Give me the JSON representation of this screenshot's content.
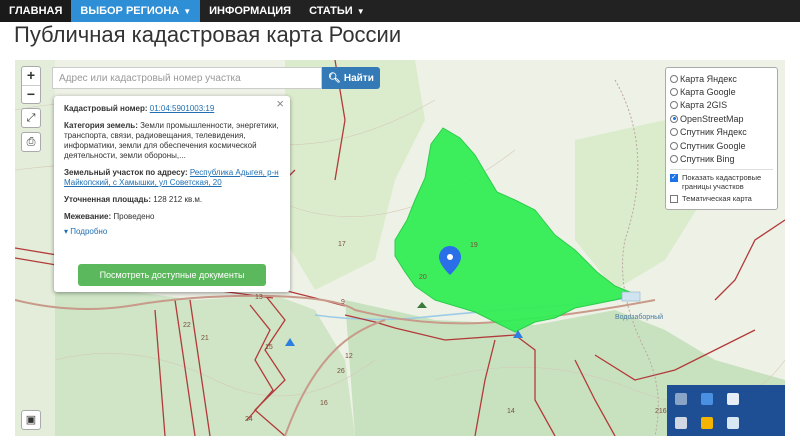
{
  "nav": {
    "items": [
      {
        "label": "ГЛАВНАЯ"
      },
      {
        "label": "ВЫБОР РЕГИОНА"
      },
      {
        "label": "ИНФОРМАЦИЯ"
      },
      {
        "label": "СТАТЬИ"
      }
    ]
  },
  "page": {
    "title": "Публичная кадастровая карта России"
  },
  "search": {
    "placeholder": "Адрес или кадастровый номер участка",
    "button_label": "Найти"
  },
  "info": {
    "cadastral_label": "Кадастровый номер:",
    "cadastral_value": "01:04:5901003:19",
    "category_label": "Категория земель:",
    "category_value": "Земли промышленности, энергетики, транспорта, связи, радиовещания, телевидения, информатики, земли для обеспечения космической деятельности, земли обороны,...",
    "address_label": "Земельный участок по адресу:",
    "address_value": "Республика Адыгея, р-н Майкопский, с Хамышки, ул Советская, 20",
    "area_label": "Уточненная площадь:",
    "area_value": "128 212 кв.м.",
    "survey_label": "Межевание:",
    "survey_value": "Проведено",
    "more_label": "Подробно",
    "docs_button": "Посмотреть доступные документы"
  },
  "layers": {
    "options": [
      {
        "label": "Карта Яндекс",
        "selected": false
      },
      {
        "label": "Карта Google",
        "selected": false
      },
      {
        "label": "Карта 2GIS",
        "selected": false
      },
      {
        "label": "OpenStreetMap",
        "selected": true
      },
      {
        "label": "Спутник Яндекс",
        "selected": false
      },
      {
        "label": "Спутник Google",
        "selected": false
      },
      {
        "label": "Спутник Bing",
        "selected": false
      }
    ],
    "show_borders": "Показать кадастровые границы участков",
    "thematic": "Тематическая карта"
  },
  "map_labels": {
    "l17": "17",
    "l20": "20",
    "l9": "9",
    "l15": "15",
    "l13": "13",
    "l12": "12",
    "l16": "16",
    "l24": "24",
    "l22": "22",
    "l21": "21",
    "l26": "26",
    "l14": "14",
    "l19": "19",
    "l216": "216",
    "reservoir": "Водозаборный"
  },
  "colors": {
    "nav_bg": "#222222",
    "region_active": "#2e8fd6",
    "parcel_fill": "#33ee55",
    "road": "#b23a3a",
    "search_button": "#337ab7",
    "docs_button": "#5cb85c"
  }
}
